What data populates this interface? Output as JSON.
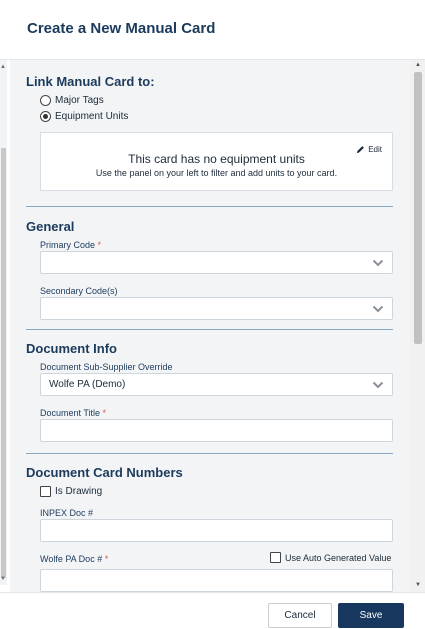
{
  "dialog": {
    "title": "Create a New Manual Card"
  },
  "link_section": {
    "title": "Link Manual Card to:",
    "options": [
      {
        "label": "Major Tags",
        "selected": false
      },
      {
        "label": "Equipment Units",
        "selected": true
      }
    ],
    "units_box": {
      "message": "This card has no equipment units",
      "hint": "Use the panel on your left to filter and add units to your card.",
      "edit_label": "Edit"
    }
  },
  "general_section": {
    "title": "General",
    "primary_code": {
      "label": "Primary Code",
      "required_mark": "*",
      "value": ""
    },
    "secondary_codes": {
      "label": "Secondary Code(s)",
      "value": ""
    }
  },
  "document_info": {
    "title": "Document Info",
    "sub_supplier": {
      "label": "Document Sub-Supplier Override",
      "value": "Wolfe PA (Demo)"
    },
    "document_title": {
      "label": "Document Title",
      "required_mark": "*",
      "value": ""
    }
  },
  "card_numbers": {
    "title": "Document Card Numbers",
    "is_drawing": {
      "label": "Is Drawing",
      "checked": false
    },
    "inpex_doc": {
      "label": "INPEX Doc #",
      "value": ""
    },
    "wolfe_doc": {
      "label": "Wolfe PA Doc #",
      "required_mark": "*",
      "value": ""
    },
    "auto_generate": {
      "label": "Use Auto Generated Value",
      "checked": false
    }
  },
  "footer": {
    "cancel_label": "Cancel",
    "save_label": "Save"
  },
  "colors": {
    "primary": "#17375e",
    "required": "#d9534f",
    "divider": "#8aa7c4",
    "panel_bg": "#f3f4f6"
  },
  "icons": {
    "edit": "pencil-icon",
    "dropdown": "chevron-down-icon"
  }
}
